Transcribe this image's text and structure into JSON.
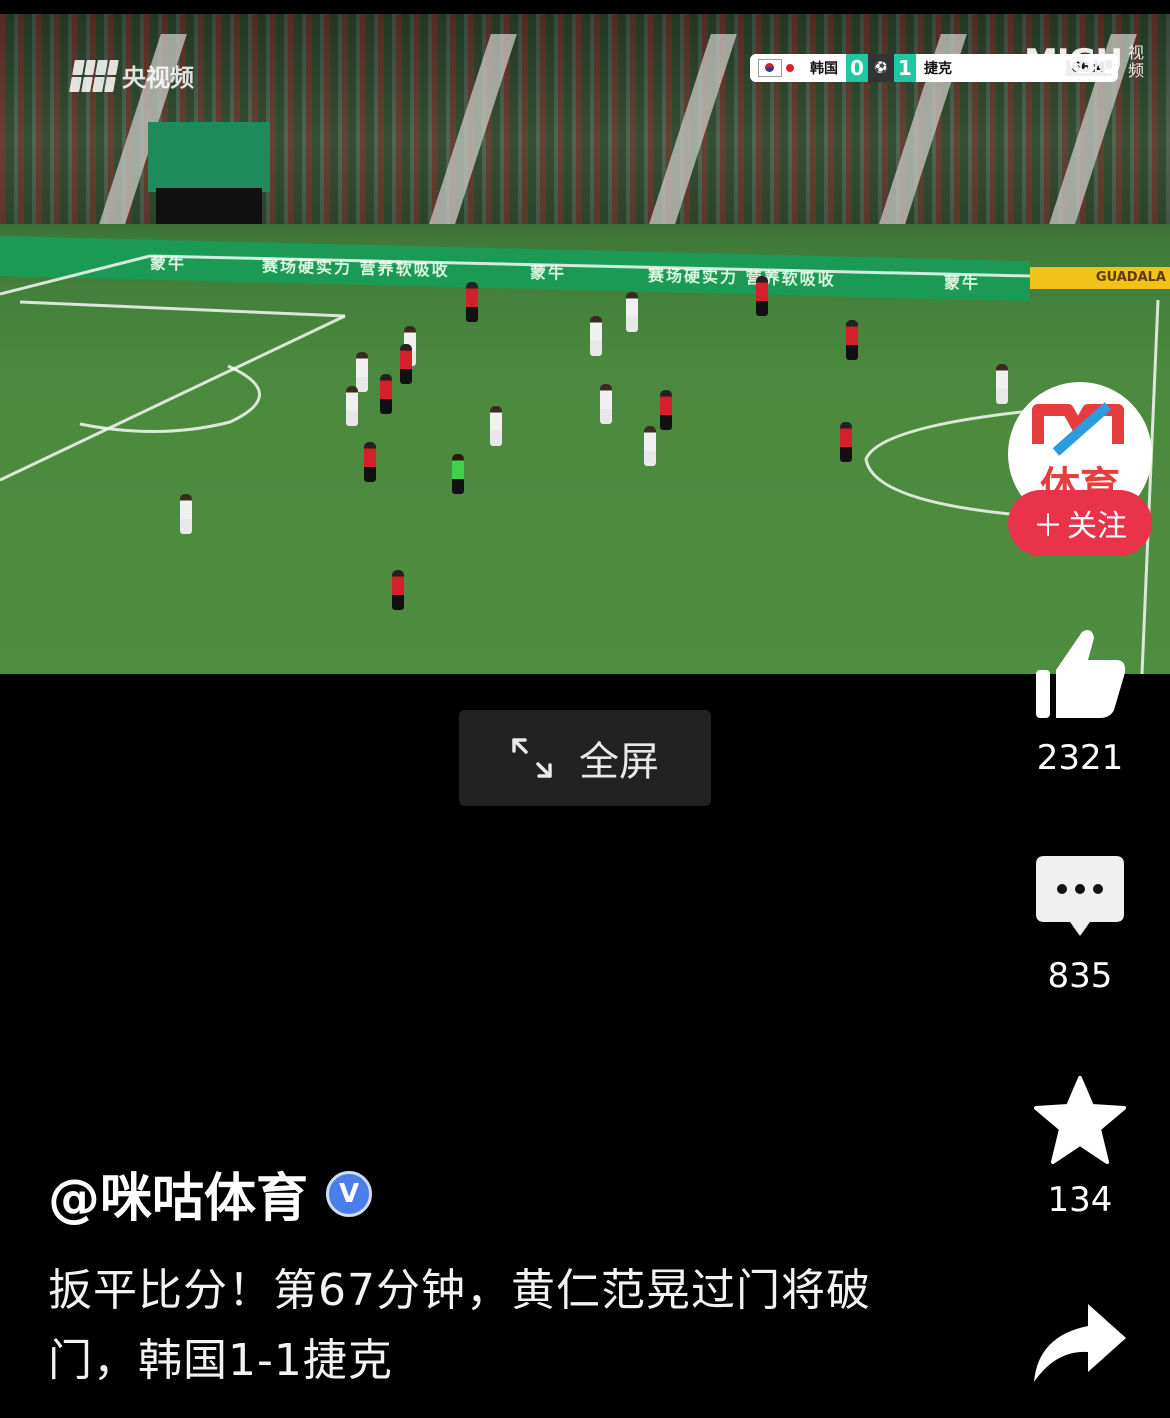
{
  "video": {
    "watermark_left": "央视频",
    "scorebug": {
      "home_team": "韩国",
      "home_score": "0",
      "away_team": "捷克",
      "away_score": "1",
      "clock": "66:4"
    },
    "watermark_right_brand": "MIGU",
    "watermark_right_sub": "视频",
    "adboard_text_1": "赛场硬实力 营养软吸收",
    "adboard_text_2": "赛场硬实力 营养软吸收",
    "adboard_brand": "蒙牛",
    "adboard_yellow": "GUADALA"
  },
  "player_controls": {
    "fullscreen_label": "全屏",
    "icon": "expand-arrows-icon"
  },
  "account": {
    "avatar_text": "体育",
    "follow_label": "关注",
    "follow_icon": "plus-icon"
  },
  "actions": {
    "like_count": "2321",
    "comment_count": "835",
    "favorite_count": "134",
    "like_icon": "thumbs-up-icon",
    "comment_icon": "comment-bubble-icon",
    "favorite_icon": "star-icon",
    "share_icon": "share-arrow-icon"
  },
  "post": {
    "author": "@咪咕体育",
    "verified_badge": "V",
    "caption": "扳平比分！第67分钟，黄仁范晃过门将破门，韩国1-1捷克"
  },
  "colors": {
    "background": "#000000",
    "follow_red": "#e8334a",
    "verified_blue": "#4a7ee8",
    "score_teal": "#1fc8a2"
  }
}
